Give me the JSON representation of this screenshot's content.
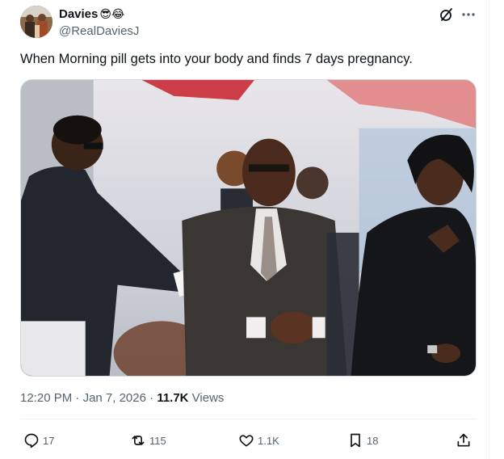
{
  "author": {
    "display_name": "Davies",
    "emojis": "😎😂",
    "handle": "@RealDaviesJ",
    "avatar_icon": "avatar-photo"
  },
  "header_icons": {
    "grok": "grok-icon",
    "more": "more-icon"
  },
  "tweet": {
    "text": "When Morning pill gets into your body and finds 7 days pregnancy."
  },
  "media": {
    "type": "photo"
  },
  "meta": {
    "time": "12:20 PM",
    "separator1": " · ",
    "date": "Jan 7, 2026",
    "separator2": " · ",
    "views_count": "11.7K",
    "views_label": " Views"
  },
  "actions": {
    "reply_count": "17",
    "repost_count": "115",
    "like_count": "1.1K",
    "bookmark_count": "18"
  },
  "colors": {
    "text_primary": "#0f1419",
    "text_secondary": "#536471",
    "border": "#eff3f4"
  }
}
